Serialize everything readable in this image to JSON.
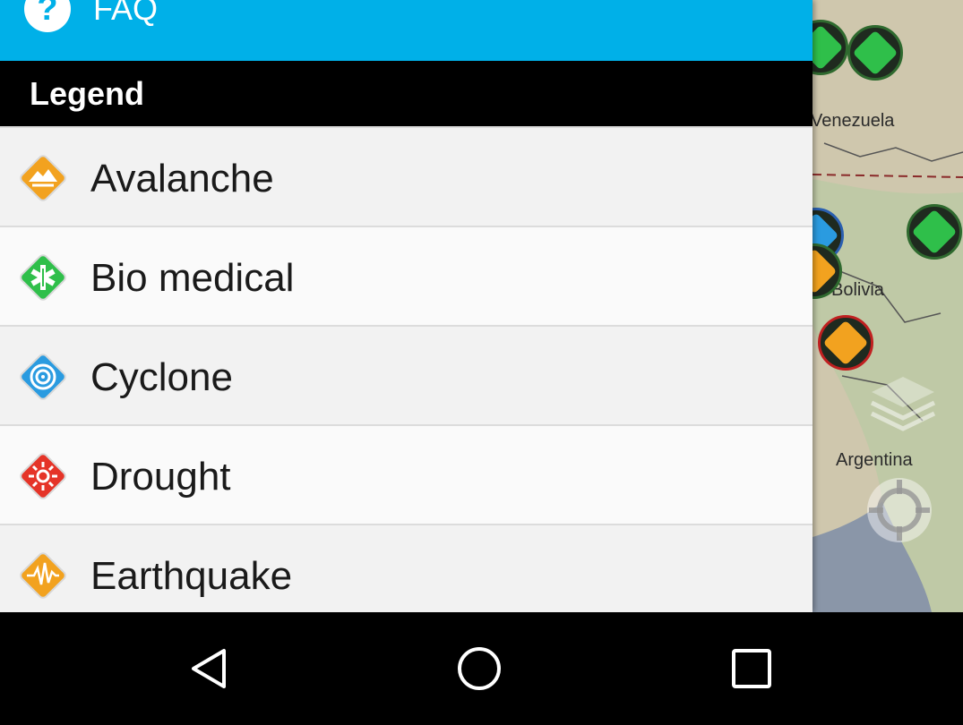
{
  "drawer": {
    "faq_label": "FAQ",
    "faq_icon_glyph": "?",
    "legend_title": "Legend",
    "items": [
      {
        "label": "Avalanche",
        "icon": "avalanche-icon",
        "color": "#f2a21f"
      },
      {
        "label": "Bio medical",
        "icon": "bio-medical-icon",
        "color": "#2fbf4a"
      },
      {
        "label": "Cyclone",
        "icon": "cyclone-icon",
        "color": "#2a9be0"
      },
      {
        "label": "Drought",
        "icon": "drought-icon",
        "color": "#e53428"
      },
      {
        "label": "Earthquake",
        "icon": "earthquake-icon",
        "color": "#f2a21f"
      }
    ]
  },
  "map": {
    "labels": [
      "Venezuela",
      "Bolivia",
      "Argentina"
    ]
  },
  "colors": {
    "faq_bar": "#00b0e8",
    "legend_header": "#000000"
  },
  "navbar": {
    "back": "back-icon",
    "home": "home-icon",
    "recents": "recents-icon"
  }
}
